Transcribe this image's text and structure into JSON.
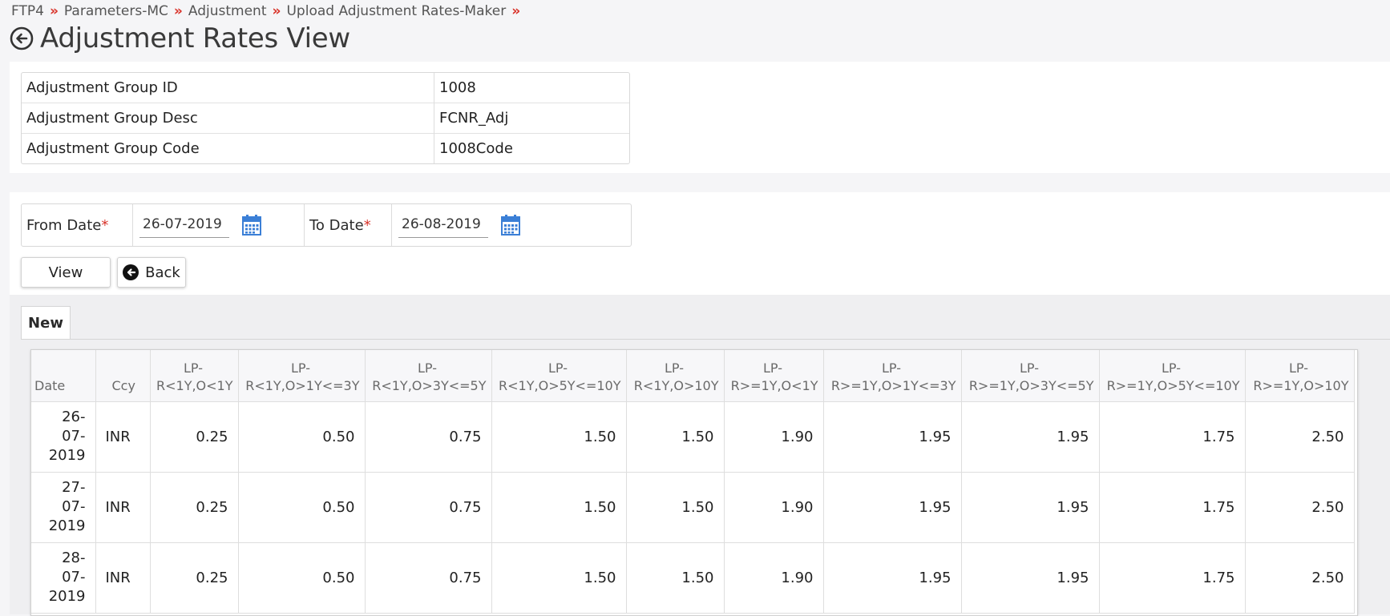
{
  "breadcrumb": [
    "FTP4",
    "Parameters-MC",
    "Adjustment",
    "Upload Adjustment Rates-Maker"
  ],
  "breadcrumb_separator": "»",
  "page_title": "Adjustment Rates View",
  "info": [
    {
      "label": "Adjustment Group ID",
      "value": "1008"
    },
    {
      "label": "Adjustment Group Desc",
      "value": "FCNR_Adj"
    },
    {
      "label": "Adjustment Group Code",
      "value": "1008Code"
    }
  ],
  "filters": {
    "from_label": "From Date",
    "from_value": "26-07-2019",
    "to_label": "To Date",
    "to_value": "26-08-2019",
    "required_marker": "*"
  },
  "buttons": {
    "view": "View",
    "back": "Back"
  },
  "tab_label": "New",
  "grid": {
    "columns": [
      {
        "top": "",
        "bottom": "Date"
      },
      {
        "top": "",
        "bottom": "Ccy"
      },
      {
        "top": "LP-",
        "bottom": "R<1Y,O<1Y"
      },
      {
        "top": "LP-",
        "bottom": "R<1Y,O>1Y<=3Y"
      },
      {
        "top": "LP-",
        "bottom": "R<1Y,O>3Y<=5Y"
      },
      {
        "top": "LP-",
        "bottom": "R<1Y,O>5Y<=10Y"
      },
      {
        "top": "LP-",
        "bottom": "R<1Y,O>10Y"
      },
      {
        "top": "LP-",
        "bottom": "R>=1Y,O<1Y"
      },
      {
        "top": "LP-",
        "bottom": "R>=1Y,O>1Y<=3Y"
      },
      {
        "top": "LP-",
        "bottom": "R>=1Y,O>3Y<=5Y"
      },
      {
        "top": "LP-",
        "bottom": "R>=1Y,O>5Y<=10Y"
      },
      {
        "top": "LP-",
        "bottom": "R>=1Y,O>10Y"
      }
    ],
    "rows": [
      {
        "date": [
          "26-",
          "07-",
          "2019"
        ],
        "ccy": "INR",
        "values": [
          "0.25",
          "0.50",
          "0.75",
          "1.50",
          "1.50",
          "1.90",
          "1.95",
          "1.95",
          "1.75",
          "2.50"
        ]
      },
      {
        "date": [
          "27-",
          "07-",
          "2019"
        ],
        "ccy": "INR",
        "values": [
          "0.25",
          "0.50",
          "0.75",
          "1.50",
          "1.50",
          "1.90",
          "1.95",
          "1.95",
          "1.75",
          "2.50"
        ]
      },
      {
        "date": [
          "28-",
          "07-",
          "2019"
        ],
        "ccy": "INR",
        "values": [
          "0.25",
          "0.50",
          "0.75",
          "1.50",
          "1.50",
          "1.90",
          "1.95",
          "1.95",
          "1.75",
          "2.50"
        ]
      }
    ]
  },
  "colors": {
    "accent": "#d9342b",
    "calendar": "#3b7fd6"
  },
  "icons": {
    "back": "circle-arrow-left-icon",
    "calendar": "calendar-icon"
  }
}
